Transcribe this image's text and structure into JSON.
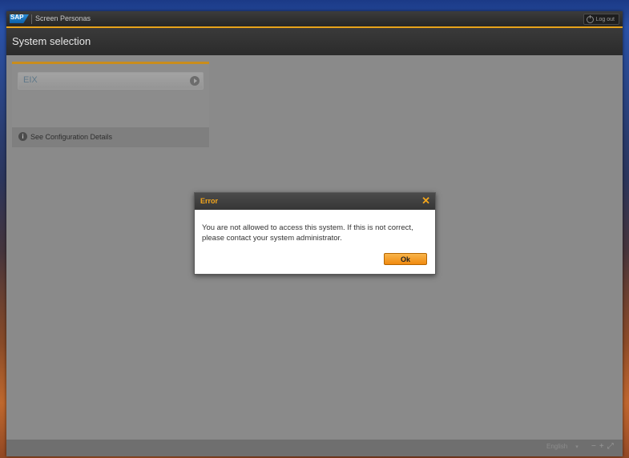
{
  "app": {
    "brand": "SAP",
    "product_name": "Screen Personas",
    "logout_label": "Log out",
    "accent_color": "#e8a31a"
  },
  "page": {
    "title": "System selection"
  },
  "systems": [
    {
      "label": "EIX"
    }
  ],
  "tile": {
    "config_link": "See Configuration Details",
    "info_glyph": "i"
  },
  "footer": {
    "language": "English",
    "caret": "▾",
    "zoom_out": "−",
    "zoom_in": "+",
    "fullscreen": "⤢"
  },
  "dialog": {
    "title": "Error",
    "message": "You are not allowed to access this system. If this is not correct, please contact your system administrator.",
    "ok_label": "Ok",
    "close_glyph": "✕",
    "title_color": "#f2a51c"
  }
}
